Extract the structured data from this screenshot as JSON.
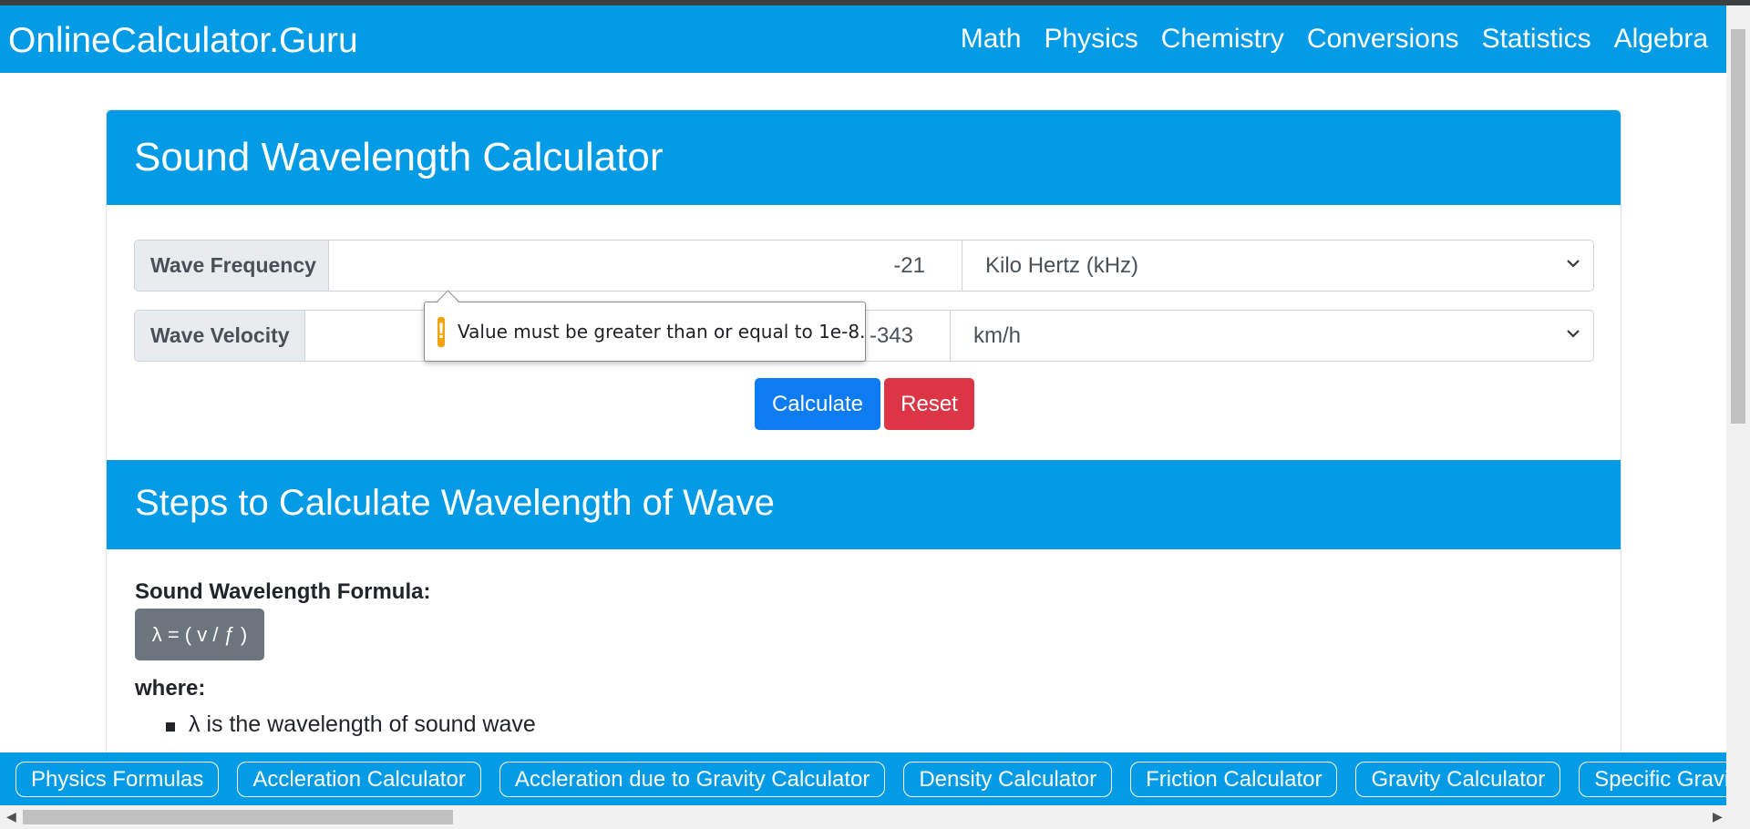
{
  "brand": "OnlineCalculator.Guru",
  "nav": [
    "Math",
    "Physics",
    "Chemistry",
    "Conversions",
    "Statistics",
    "Algebra"
  ],
  "calculator": {
    "title": "Sound Wavelength Calculator",
    "frequency": {
      "label": "Wave Frequency",
      "value": "-21",
      "unit": "Kilo Hertz (kHz)"
    },
    "velocity": {
      "label": "Wave Velocity",
      "value": "-343",
      "unit": "km/h"
    },
    "calculate_label": "Calculate",
    "reset_label": "Reset"
  },
  "tooltip": {
    "text": "Value must be greater than or equal to 1e-8.",
    "icon": "warning-icon"
  },
  "steps": {
    "title": "Steps to Calculate Wavelength of Wave",
    "formula_label": "Sound Wavelength Formula:",
    "formula": "λ = ( v / ƒ )",
    "where_label": "where:",
    "items": [
      "λ is the wavelength of sound wave"
    ]
  },
  "related": [
    "Physics Formulas",
    "Accleration Calculator",
    "Accleration due to Gravity Calculator",
    "Density Calculator",
    "Friction Calculator",
    "Gravity Calculator",
    "Specific Gravity"
  ],
  "colors": {
    "brand_blue": "#039be5",
    "calculate": "#0d7cf2",
    "reset": "#dc3545",
    "formula_bg": "#6c757d",
    "warning": "#f0a30a"
  }
}
